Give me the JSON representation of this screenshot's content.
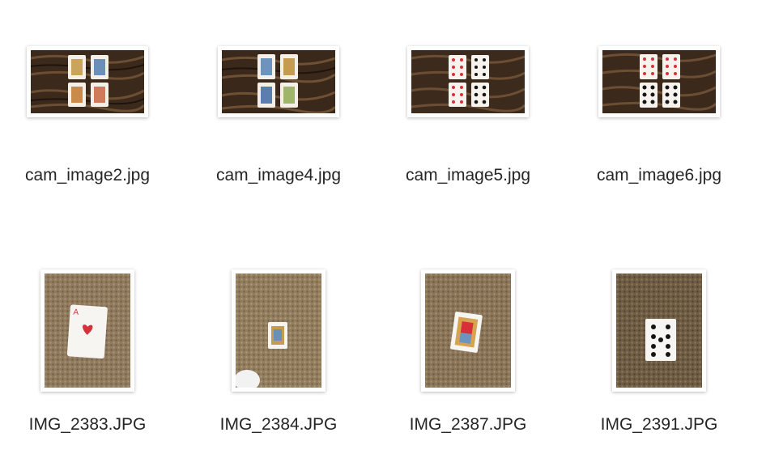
{
  "files": [
    {
      "name": "cam_image2.jpg",
      "thumb": "wood-four-faces",
      "icon": "image-thumbnail-icon"
    },
    {
      "name": "cam_image4.jpg",
      "thumb": "wood-four-faces",
      "icon": "image-thumbnail-icon"
    },
    {
      "name": "cam_image5.jpg",
      "thumb": "wood-hearts-spades",
      "icon": "image-thumbnail-icon"
    },
    {
      "name": "cam_image6.jpg",
      "thumb": "wood-hearts-spades",
      "icon": "image-thumbnail-icon"
    },
    {
      "name": "IMG_2383.JPG",
      "thumb": "carpet-ace-hearts",
      "icon": "image-thumbnail-icon"
    },
    {
      "name": "IMG_2384.JPG",
      "thumb": "carpet-king-small",
      "icon": "image-thumbnail-icon"
    },
    {
      "name": "IMG_2387.JPG",
      "thumb": "carpet-queen-diamonds",
      "icon": "image-thumbnail-icon"
    },
    {
      "name": "IMG_2391.JPG",
      "thumb": "carpet-nine-spades",
      "icon": "image-thumbnail-icon"
    }
  ],
  "colors": {
    "wood": "#3b2a1c",
    "carpet": "#8f7a5e",
    "card_red": "#d8303a",
    "card_black": "#151515",
    "label_text": "#262626"
  }
}
